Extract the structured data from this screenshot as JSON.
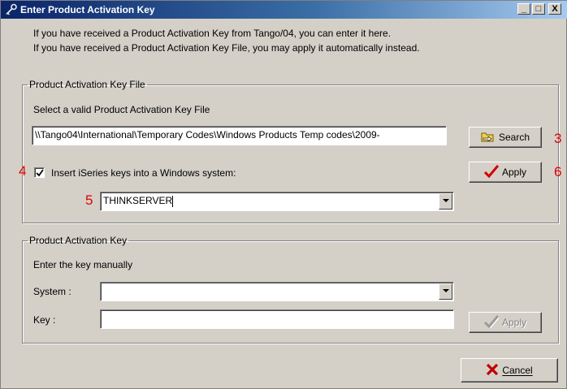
{
  "window": {
    "title": "Enter Product Activation Key",
    "minimize": "_",
    "maximize": "□",
    "close": "X"
  },
  "intro": {
    "line1": "If you have received a Product Activation Key from Tango/04, you can enter it here.",
    "line2": "If you have received a Product Activation Key File, you may apply it automatically instead."
  },
  "key_file_group": {
    "legend": "Product Activation Key File",
    "instruction": "Select a valid Product Activation Key File",
    "path_value": "\\\\Tango04\\International\\Temporary Codes\\Windows Products Temp codes\\2009-",
    "search_label": "Search",
    "checkbox_label": "Insert iSeries keys into a Windows system:",
    "checkbox_checked": true,
    "system_value": "THINKSERVER",
    "apply_label": "Apply"
  },
  "key_group": {
    "legend": "Product Activation Key",
    "instruction": "Enter the key manually",
    "system_label": "System :",
    "system_value": "",
    "key_label": "Key :",
    "key_value": "",
    "apply_label": "Apply",
    "apply_enabled": false
  },
  "cancel_label": "Cancel",
  "annotations": {
    "m3": "3",
    "m4": "4",
    "m5": "5",
    "m6": "6"
  },
  "colors": {
    "title_gradient_start": "#0a246a",
    "title_gradient_end": "#a6caf0",
    "annotation": "#e00000",
    "check_mark": "#d40000",
    "cancel_x": "#c00000"
  }
}
